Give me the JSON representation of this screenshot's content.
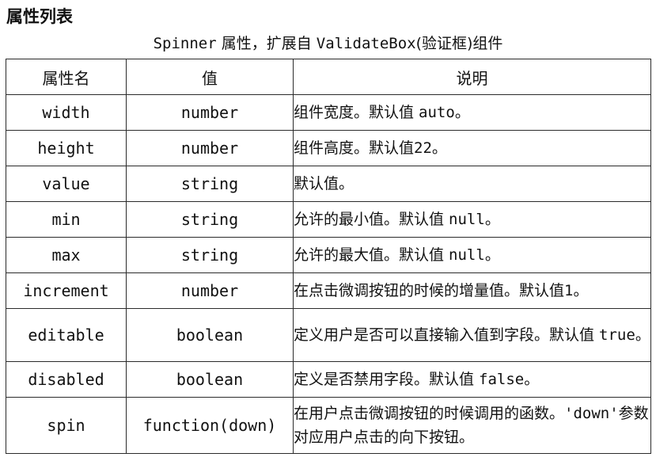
{
  "heading": "属性列表",
  "caption": {
    "prefix": "Spinner",
    "middle": " 属性，扩展自 ",
    "base": "ValidateBox",
    "suffix": "(验证框)组件"
  },
  "table": {
    "headers": [
      "属性名",
      "值",
      "说明"
    ],
    "rows": [
      {
        "name": "width",
        "type": "number",
        "desc": [
          {
            "t": "组件宽度。默认值 "
          },
          {
            "t": "auto",
            "mono": true
          },
          {
            "t": "。"
          }
        ]
      },
      {
        "name": "height",
        "type": "number",
        "desc": [
          {
            "t": "组件高度。默认值"
          },
          {
            "t": "22",
            "mono": true
          },
          {
            "t": "。"
          }
        ]
      },
      {
        "name": "value",
        "type": "string",
        "desc": [
          {
            "t": "默认值。"
          }
        ]
      },
      {
        "name": "min",
        "type": "string",
        "desc": [
          {
            "t": "允许的最小值。默认值 "
          },
          {
            "t": "null",
            "mono": true
          },
          {
            "t": "。"
          }
        ]
      },
      {
        "name": "max",
        "type": "string",
        "desc": [
          {
            "t": "允许的最大值。默认值 "
          },
          {
            "t": "null",
            "mono": true
          },
          {
            "t": "。"
          }
        ]
      },
      {
        "name": "increment",
        "type": "number",
        "desc": [
          {
            "t": "在点击微调按钮的时候的增量值。默认值"
          },
          {
            "t": "1",
            "mono": true
          },
          {
            "t": "。"
          }
        ]
      },
      {
        "name": "editable",
        "type": "boolean",
        "desc": [
          {
            "t": "定义用户是否可以直接输入值到字段。默认值 "
          },
          {
            "t": "true",
            "mono": true
          },
          {
            "t": "。"
          }
        ]
      },
      {
        "name": "disabled",
        "type": "boolean",
        "desc": [
          {
            "t": "定义是否禁用字段。默认值 "
          },
          {
            "t": "false",
            "mono": true
          },
          {
            "t": "。"
          }
        ]
      },
      {
        "name": "spin",
        "type": "function(down)",
        "desc": [
          {
            "t": "在用户点击微调按钮的时候调用的函数。"
          },
          {
            "t": "'down'",
            "mono": true
          },
          {
            "t": "参数对应用户点击的向下按钮。"
          }
        ]
      }
    ]
  }
}
